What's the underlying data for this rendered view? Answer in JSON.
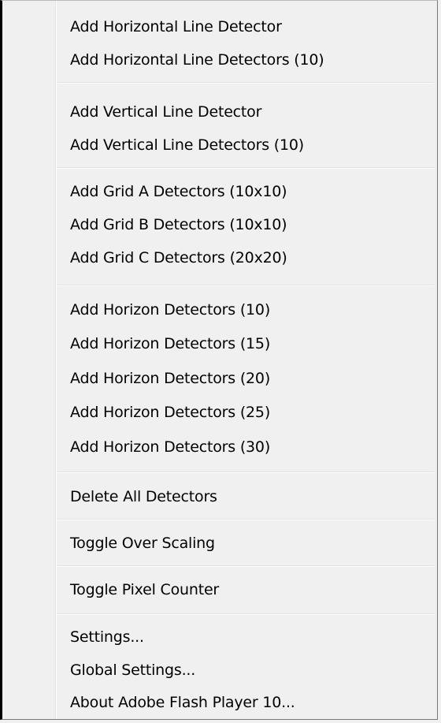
{
  "menu": {
    "items": [
      "Add Horizontal Line Detector",
      "Add Horizontal Line Detectors (10)",
      "Add Vertical Line Detector",
      "Add Vertical Line Detectors (10)",
      "Add Grid A Detectors (10x10)",
      "Add Grid B Detectors (10x10)",
      "Add Grid C Detectors (20x20)",
      "Add Horizon Detectors (10)",
      "Add Horizon Detectors (15)",
      "Add Horizon Detectors (20)",
      "Add Horizon Detectors (25)",
      "Add Horizon Detectors (30)",
      "Delete All Detectors",
      "Toggle Over Scaling",
      "Toggle Pixel Counter",
      "Settings...",
      "Global Settings...",
      "About Adobe Flash Player 10..."
    ]
  }
}
